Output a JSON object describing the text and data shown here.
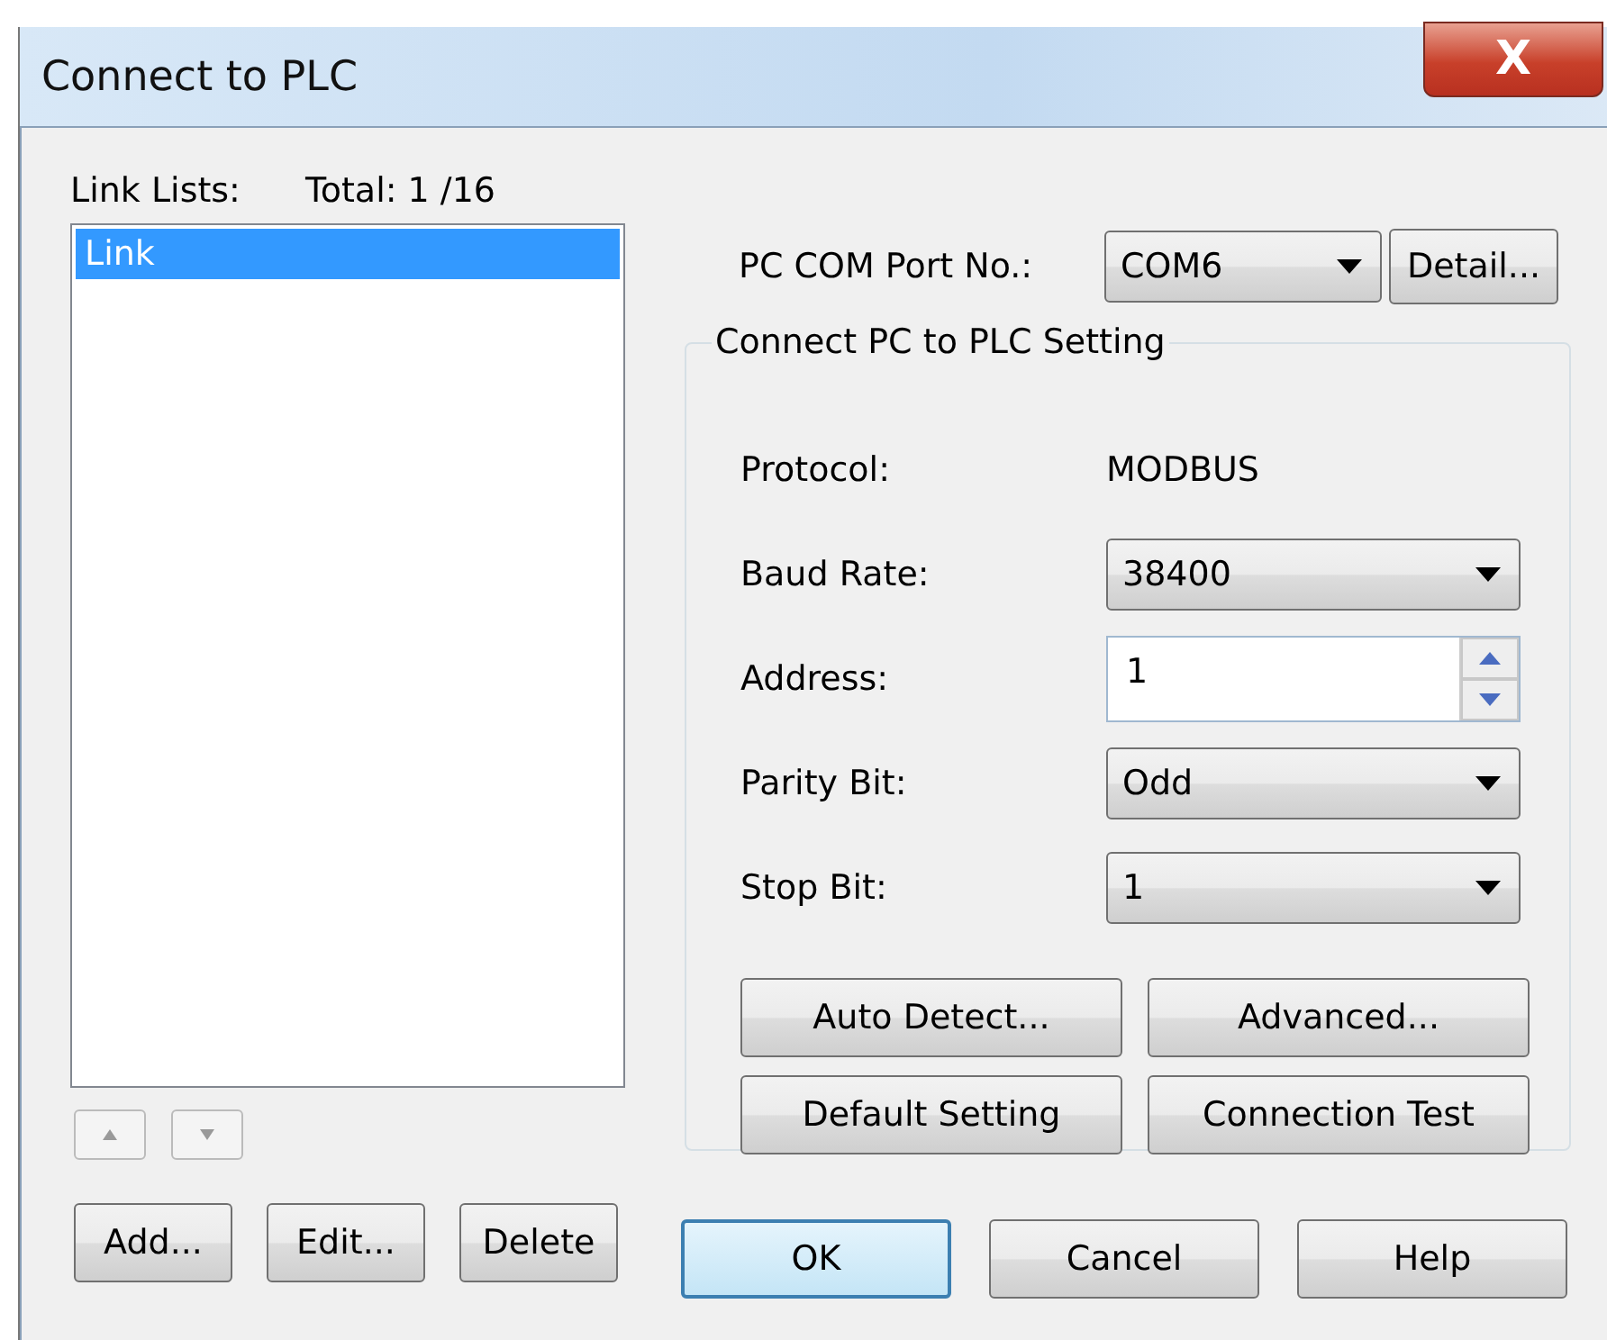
{
  "window": {
    "title": "Connect to PLC",
    "close_label": "X"
  },
  "link_list": {
    "label": "Link Lists:",
    "total": "Total:  1 /16",
    "items": [
      {
        "name": "Link",
        "selected": true
      }
    ],
    "move_buttons": [
      {
        "kind": "up",
        "disabled": true
      },
      {
        "kind": "down",
        "disabled": true
      }
    ],
    "buttons": [
      "Add...",
      "Edit...",
      "Delete"
    ]
  },
  "com_port": {
    "label": "PC COM Port No.:",
    "value": "COM6",
    "detail_button": "Detail..."
  },
  "setting_group": {
    "title": "Connect PC to PLC Setting",
    "rows": [
      {
        "kind": "text",
        "label": "Protocol:",
        "value": "MODBUS"
      },
      {
        "kind": "dropdown",
        "label": "Baud Rate:",
        "value": "38400"
      },
      {
        "kind": "spinner",
        "label": "Address:",
        "value": "1"
      },
      {
        "kind": "dropdown",
        "label": "Parity Bit:",
        "value": "Odd"
      },
      {
        "kind": "dropdown",
        "label": "Stop Bit:",
        "value": "1"
      }
    ],
    "buttons": [
      "Auto Detect...",
      "Advanced...",
      "Default Setting",
      "Connection Test"
    ]
  },
  "dialog_buttons": [
    {
      "label": "OK",
      "default": true
    },
    {
      "label": "Cancel",
      "default": false
    },
    {
      "label": "Help",
      "default": false
    }
  ]
}
